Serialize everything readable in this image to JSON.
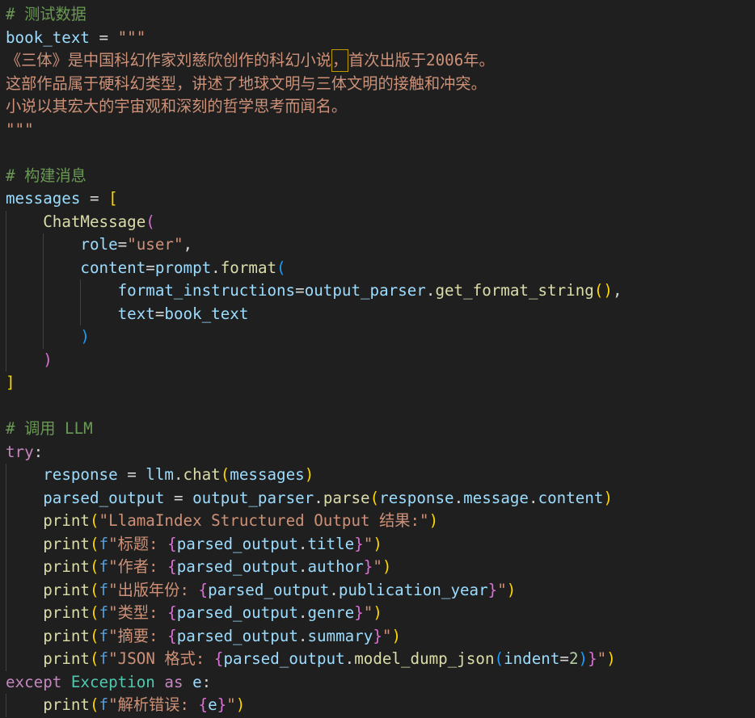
{
  "theme": {
    "background": "#1f1f1f",
    "default_text": "#d4d4d4",
    "indent_guide": "#404040"
  },
  "editor": {
    "lines": [
      [
        {
          "text": "# 测试数据",
          "color": "#6a9955"
        }
      ],
      [
        {
          "text": "book_text",
          "color": "#9cdcfe"
        },
        {
          "text": " = ",
          "color": "#d4d4d4"
        },
        {
          "text": "\"\"\"",
          "color": "#ce9178"
        }
      ],
      [
        {
          "text": "《三体》是中国科幻作家刘慈欣创作的科幻小说",
          "color": "#ce9178"
        },
        {
          "text": "，",
          "color": "#ce9178",
          "highlight_border": "#bd9b03"
        },
        {
          "text": "首次出版于2006年。",
          "color": "#ce9178"
        }
      ],
      [
        {
          "text": "这部作品属于硬科幻类型，讲述了地球文明与三体文明的接触和冲突。",
          "color": "#ce9178"
        }
      ],
      [
        {
          "text": "小说以其宏大的宇宙观和深刻的哲学思考而闻名。",
          "color": "#ce9178"
        }
      ],
      [
        {
          "text": "\"\"\"",
          "color": "#ce9178"
        }
      ],
      [],
      [
        {
          "text": "# 构建消息",
          "color": "#6a9955"
        }
      ],
      [
        {
          "text": "messages",
          "color": "#9cdcfe"
        },
        {
          "text": " = ",
          "color": "#d4d4d4"
        },
        {
          "text": "[",
          "color": "#ffd700"
        }
      ],
      [
        {
          "text": "    "
        },
        {
          "text": "ChatMessage",
          "color": "#dcdcaa"
        },
        {
          "text": "(",
          "color": "#da70d6"
        }
      ],
      [
        {
          "text": "        "
        },
        {
          "text": "role",
          "color": "#9cdcfe"
        },
        {
          "text": "=",
          "color": "#d4d4d4"
        },
        {
          "text": "\"user\"",
          "color": "#ce9178"
        },
        {
          "text": ",",
          "color": "#d4d4d4"
        }
      ],
      [
        {
          "text": "        "
        },
        {
          "text": "content",
          "color": "#9cdcfe"
        },
        {
          "text": "=",
          "color": "#d4d4d4"
        },
        {
          "text": "prompt",
          "color": "#9cdcfe"
        },
        {
          "text": ".",
          "color": "#d4d4d4"
        },
        {
          "text": "format",
          "color": "#dcdcaa"
        },
        {
          "text": "(",
          "color": "#179fff"
        }
      ],
      [
        {
          "text": "            "
        },
        {
          "text": "format_instructions",
          "color": "#9cdcfe"
        },
        {
          "text": "=",
          "color": "#d4d4d4"
        },
        {
          "text": "output_parser",
          "color": "#9cdcfe"
        },
        {
          "text": ".",
          "color": "#d4d4d4"
        },
        {
          "text": "get_format_string",
          "color": "#dcdcaa"
        },
        {
          "text": "()",
          "color": "#ffd700"
        },
        {
          "text": ",",
          "color": "#d4d4d4"
        }
      ],
      [
        {
          "text": "            "
        },
        {
          "text": "text",
          "color": "#9cdcfe"
        },
        {
          "text": "=",
          "color": "#d4d4d4"
        },
        {
          "text": "book_text",
          "color": "#9cdcfe"
        }
      ],
      [
        {
          "text": "        "
        },
        {
          "text": ")",
          "color": "#179fff"
        }
      ],
      [
        {
          "text": "    "
        },
        {
          "text": ")",
          "color": "#da70d6"
        }
      ],
      [
        {
          "text": "]",
          "color": "#ffd700"
        }
      ],
      [],
      [
        {
          "text": "# 调用 LLM",
          "color": "#6a9955"
        }
      ],
      [
        {
          "text": "try",
          "color": "#c586c0"
        },
        {
          "text": ":",
          "color": "#d4d4d4"
        }
      ],
      [
        {
          "text": "    "
        },
        {
          "text": "response",
          "color": "#9cdcfe"
        },
        {
          "text": " = ",
          "color": "#d4d4d4"
        },
        {
          "text": "llm",
          "color": "#9cdcfe"
        },
        {
          "text": ".",
          "color": "#d4d4d4"
        },
        {
          "text": "chat",
          "color": "#dcdcaa"
        },
        {
          "text": "(",
          "color": "#ffd700"
        },
        {
          "text": "messages",
          "color": "#9cdcfe"
        },
        {
          "text": ")",
          "color": "#ffd700"
        }
      ],
      [
        {
          "text": "    "
        },
        {
          "text": "parsed_output",
          "color": "#9cdcfe"
        },
        {
          "text": " = ",
          "color": "#d4d4d4"
        },
        {
          "text": "output_parser",
          "color": "#9cdcfe"
        },
        {
          "text": ".",
          "color": "#d4d4d4"
        },
        {
          "text": "parse",
          "color": "#dcdcaa"
        },
        {
          "text": "(",
          "color": "#ffd700"
        },
        {
          "text": "response",
          "color": "#9cdcfe"
        },
        {
          "text": ".",
          "color": "#d4d4d4"
        },
        {
          "text": "message",
          "color": "#9cdcfe"
        },
        {
          "text": ".",
          "color": "#d4d4d4"
        },
        {
          "text": "content",
          "color": "#9cdcfe"
        },
        {
          "text": ")",
          "color": "#ffd700"
        }
      ],
      [
        {
          "text": "    "
        },
        {
          "text": "print",
          "color": "#dcdcaa"
        },
        {
          "text": "(",
          "color": "#ffd700"
        },
        {
          "text": "\"LlamaIndex Structured Output 结果:\"",
          "color": "#ce9178"
        },
        {
          "text": ")",
          "color": "#ffd700"
        }
      ],
      [
        {
          "text": "    "
        },
        {
          "text": "print",
          "color": "#dcdcaa"
        },
        {
          "text": "(",
          "color": "#ffd700"
        },
        {
          "text": "f",
          "color": "#569cd6"
        },
        {
          "text": "\"标题: ",
          "color": "#ce9178"
        },
        {
          "text": "{",
          "color": "#da70d6"
        },
        {
          "text": "parsed_output",
          "color": "#9cdcfe"
        },
        {
          "text": ".",
          "color": "#d4d4d4"
        },
        {
          "text": "title",
          "color": "#9cdcfe"
        },
        {
          "text": "}",
          "color": "#da70d6"
        },
        {
          "text": "\"",
          "color": "#ce9178"
        },
        {
          "text": ")",
          "color": "#ffd700"
        }
      ],
      [
        {
          "text": "    "
        },
        {
          "text": "print",
          "color": "#dcdcaa"
        },
        {
          "text": "(",
          "color": "#ffd700"
        },
        {
          "text": "f",
          "color": "#569cd6"
        },
        {
          "text": "\"作者: ",
          "color": "#ce9178"
        },
        {
          "text": "{",
          "color": "#da70d6"
        },
        {
          "text": "parsed_output",
          "color": "#9cdcfe"
        },
        {
          "text": ".",
          "color": "#d4d4d4"
        },
        {
          "text": "author",
          "color": "#9cdcfe"
        },
        {
          "text": "}",
          "color": "#da70d6"
        },
        {
          "text": "\"",
          "color": "#ce9178"
        },
        {
          "text": ")",
          "color": "#ffd700"
        }
      ],
      [
        {
          "text": "    "
        },
        {
          "text": "print",
          "color": "#dcdcaa"
        },
        {
          "text": "(",
          "color": "#ffd700"
        },
        {
          "text": "f",
          "color": "#569cd6"
        },
        {
          "text": "\"出版年份: ",
          "color": "#ce9178"
        },
        {
          "text": "{",
          "color": "#da70d6"
        },
        {
          "text": "parsed_output",
          "color": "#9cdcfe"
        },
        {
          "text": ".",
          "color": "#d4d4d4"
        },
        {
          "text": "publication_year",
          "color": "#9cdcfe"
        },
        {
          "text": "}",
          "color": "#da70d6"
        },
        {
          "text": "\"",
          "color": "#ce9178"
        },
        {
          "text": ")",
          "color": "#ffd700"
        }
      ],
      [
        {
          "text": "    "
        },
        {
          "text": "print",
          "color": "#dcdcaa"
        },
        {
          "text": "(",
          "color": "#ffd700"
        },
        {
          "text": "f",
          "color": "#569cd6"
        },
        {
          "text": "\"类型: ",
          "color": "#ce9178"
        },
        {
          "text": "{",
          "color": "#da70d6"
        },
        {
          "text": "parsed_output",
          "color": "#9cdcfe"
        },
        {
          "text": ".",
          "color": "#d4d4d4"
        },
        {
          "text": "genre",
          "color": "#9cdcfe"
        },
        {
          "text": "}",
          "color": "#da70d6"
        },
        {
          "text": "\"",
          "color": "#ce9178"
        },
        {
          "text": ")",
          "color": "#ffd700"
        }
      ],
      [
        {
          "text": "    "
        },
        {
          "text": "print",
          "color": "#dcdcaa"
        },
        {
          "text": "(",
          "color": "#ffd700"
        },
        {
          "text": "f",
          "color": "#569cd6"
        },
        {
          "text": "\"摘要: ",
          "color": "#ce9178"
        },
        {
          "text": "{",
          "color": "#da70d6"
        },
        {
          "text": "parsed_output",
          "color": "#9cdcfe"
        },
        {
          "text": ".",
          "color": "#d4d4d4"
        },
        {
          "text": "summary",
          "color": "#9cdcfe"
        },
        {
          "text": "}",
          "color": "#da70d6"
        },
        {
          "text": "\"",
          "color": "#ce9178"
        },
        {
          "text": ")",
          "color": "#ffd700"
        }
      ],
      [
        {
          "text": "    "
        },
        {
          "text": "print",
          "color": "#dcdcaa"
        },
        {
          "text": "(",
          "color": "#ffd700"
        },
        {
          "text": "f",
          "color": "#569cd6"
        },
        {
          "text": "\"JSON 格式: ",
          "color": "#ce9178"
        },
        {
          "text": "{",
          "color": "#da70d6"
        },
        {
          "text": "parsed_output",
          "color": "#9cdcfe"
        },
        {
          "text": ".",
          "color": "#d4d4d4"
        },
        {
          "text": "model_dump_json",
          "color": "#dcdcaa"
        },
        {
          "text": "(",
          "color": "#179fff"
        },
        {
          "text": "indent",
          "color": "#9cdcfe"
        },
        {
          "text": "=",
          "color": "#d4d4d4"
        },
        {
          "text": "2",
          "color": "#b5cea8"
        },
        {
          "text": ")",
          "color": "#179fff"
        },
        {
          "text": "}",
          "color": "#da70d6"
        },
        {
          "text": "\"",
          "color": "#ce9178"
        },
        {
          "text": ")",
          "color": "#ffd700"
        }
      ],
      [
        {
          "text": "except",
          "color": "#c586c0"
        },
        {
          "text": " ",
          "color": "#d4d4d4"
        },
        {
          "text": "Exception",
          "color": "#4ec9b0"
        },
        {
          "text": " ",
          "color": "#d4d4d4"
        },
        {
          "text": "as",
          "color": "#c586c0"
        },
        {
          "text": " ",
          "color": "#d4d4d4"
        },
        {
          "text": "e",
          "color": "#9cdcfe"
        },
        {
          "text": ":",
          "color": "#d4d4d4"
        }
      ],
      [
        {
          "text": "    "
        },
        {
          "text": "print",
          "color": "#dcdcaa"
        },
        {
          "text": "(",
          "color": "#ffd700"
        },
        {
          "text": "f",
          "color": "#569cd6"
        },
        {
          "text": "\"解析错误: ",
          "color": "#ce9178"
        },
        {
          "text": "{",
          "color": "#da70d6"
        },
        {
          "text": "e",
          "color": "#9cdcfe"
        },
        {
          "text": "}",
          "color": "#da70d6"
        },
        {
          "text": "\"",
          "color": "#ce9178"
        },
        {
          "text": ")",
          "color": "#ffd700"
        }
      ]
    ]
  }
}
